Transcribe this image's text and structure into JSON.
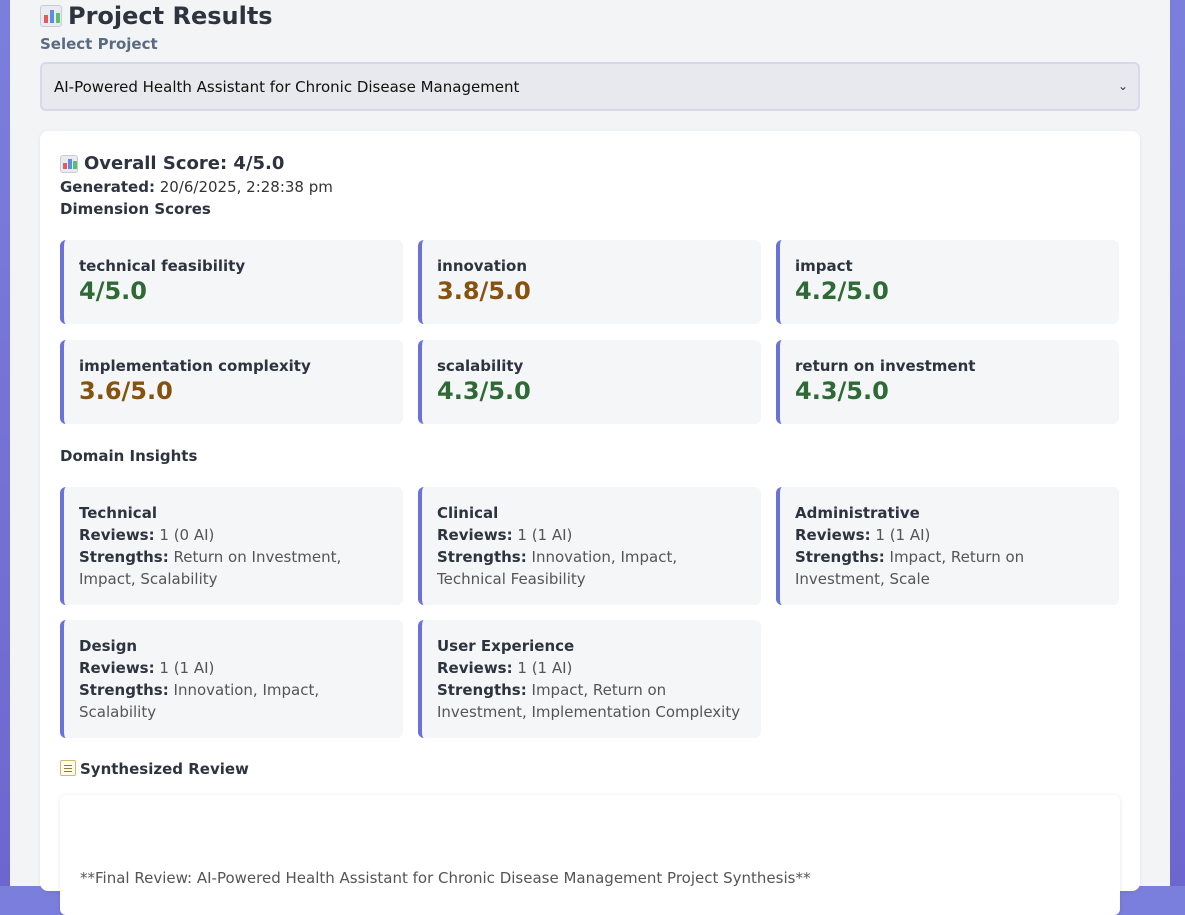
{
  "header": {
    "title": "Project Results",
    "select_label": "Select Project",
    "selected_project": "AI-Powered Health Assistant for Chronic Disease Management"
  },
  "summary": {
    "overall_label": "Overall Score: 4/5.0",
    "generated_label": "Generated:",
    "generated_value": " 20/6/2025, 2:28:38 pm",
    "dimension_title": "Dimension Scores",
    "domain_title": "Domain Insights",
    "review_title": "Synthesized Review"
  },
  "dimensions": [
    {
      "name": "technical feasibility",
      "score": "4/5.0"
    },
    {
      "name": "innovation",
      "score": "3.8/5.0"
    },
    {
      "name": "impact",
      "score": "4.2/5.0"
    },
    {
      "name": "implementation complexity",
      "score": "3.6/5.0"
    },
    {
      "name": "scalability",
      "score": "4.3/5.0"
    },
    {
      "name": "return on investment",
      "score": "4.3/5.0"
    }
  ],
  "insights": [
    {
      "domain": "Technical",
      "reviews_label": "Reviews:",
      "reviews": " 1 (0 AI)",
      "strengths_label": "Strengths:",
      "strengths": " Return on Investment, Impact, Scalability"
    },
    {
      "domain": "Clinical",
      "reviews_label": "Reviews:",
      "reviews": " 1 (1 AI)",
      "strengths_label": "Strengths:",
      "strengths": " Innovation, Impact, Technical Feasibility"
    },
    {
      "domain": "Administrative",
      "reviews_label": "Reviews:",
      "reviews": " 1 (1 AI)",
      "strengths_label": "Strengths:",
      "strengths": " Impact, Return on Investment, Scale"
    },
    {
      "domain": "Design",
      "reviews_label": "Reviews:",
      "reviews": " 1 (1 AI)",
      "strengths_label": "Strengths:",
      "strengths": " Innovation, Impact, Scalability"
    },
    {
      "domain": "User Experience",
      "reviews_label": "Reviews:",
      "reviews": " 1 (1 AI)",
      "strengths_label": "Strengths:",
      "strengths": " Impact, Return on Investment, Implementation Complexity"
    }
  ],
  "review": {
    "text": "**Final Review: AI-Powered Health Assistant for Chronic Disease Management Project Synthesis**"
  },
  "colors": {
    "accent": "#6a72d8",
    "score_high": "#2f6a36",
    "score_mid": "#85520f",
    "background": "#7b7fdc"
  },
  "icons": [
    "bar-chart-icon",
    "memo-icon",
    "chevron-down-icon"
  ]
}
